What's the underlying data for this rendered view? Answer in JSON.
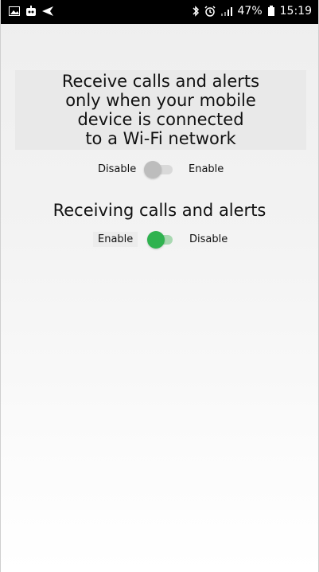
{
  "status_bar": {
    "left_icons": [
      "image-icon",
      "robot-icon",
      "send-icon"
    ],
    "right_icons": [
      "bluetooth-icon",
      "alarm-icon",
      "signal-icon"
    ],
    "battery": "47%",
    "time": "15:19"
  },
  "section1": {
    "title_lines": [
      "Receive calls and alerts",
      "only when your mobile",
      "device is connected",
      "to a Wi-Fi network"
    ],
    "left_label": "Disable",
    "right_label": "Enable",
    "toggle_state": "off"
  },
  "section2": {
    "title": "Receiving calls and alerts",
    "left_label": "Enable",
    "right_label": "Disable",
    "toggle_state": "on",
    "accent_color": "#2fb24f"
  }
}
